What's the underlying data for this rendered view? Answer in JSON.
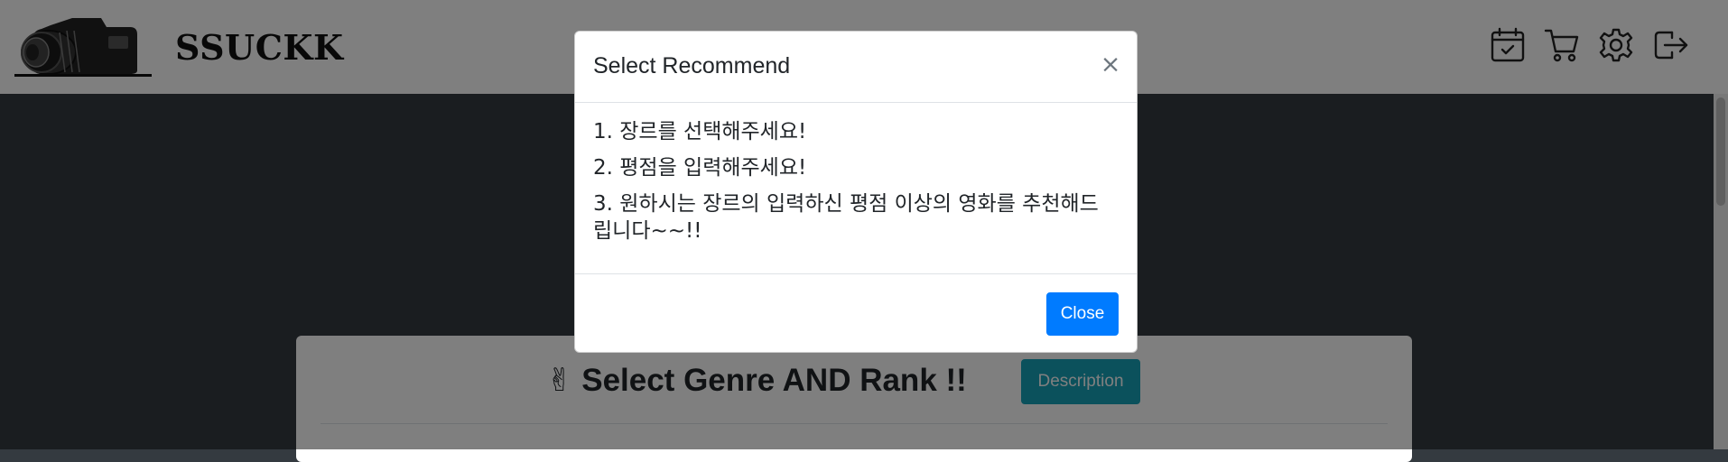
{
  "brand": {
    "name": "SSUCKK",
    "logo_icon": "camera-logo-icon"
  },
  "navbar": {
    "icons": [
      "calendar-check-icon",
      "cart-icon",
      "gear-icon",
      "logout-icon"
    ]
  },
  "card": {
    "emoji": "✌",
    "title": "Select Genre AND Rank !!",
    "description_button": "Description",
    "button_color": "#17a2b8"
  },
  "modal": {
    "title": "Select Recommend",
    "close_symbol": "×",
    "lines": [
      "1. 장르를 선택해주세요!",
      "2. 평점을 입력해주세요!",
      "3. 원하시는 장르의 입력하신 평점 이상의 영화를 추천해드립니다~~!!"
    ],
    "close_button": "Close",
    "close_button_color": "#007bff"
  },
  "colors": {
    "page_background": "#343a40",
    "backdrop": "rgba(0,0,0,0.5)"
  }
}
